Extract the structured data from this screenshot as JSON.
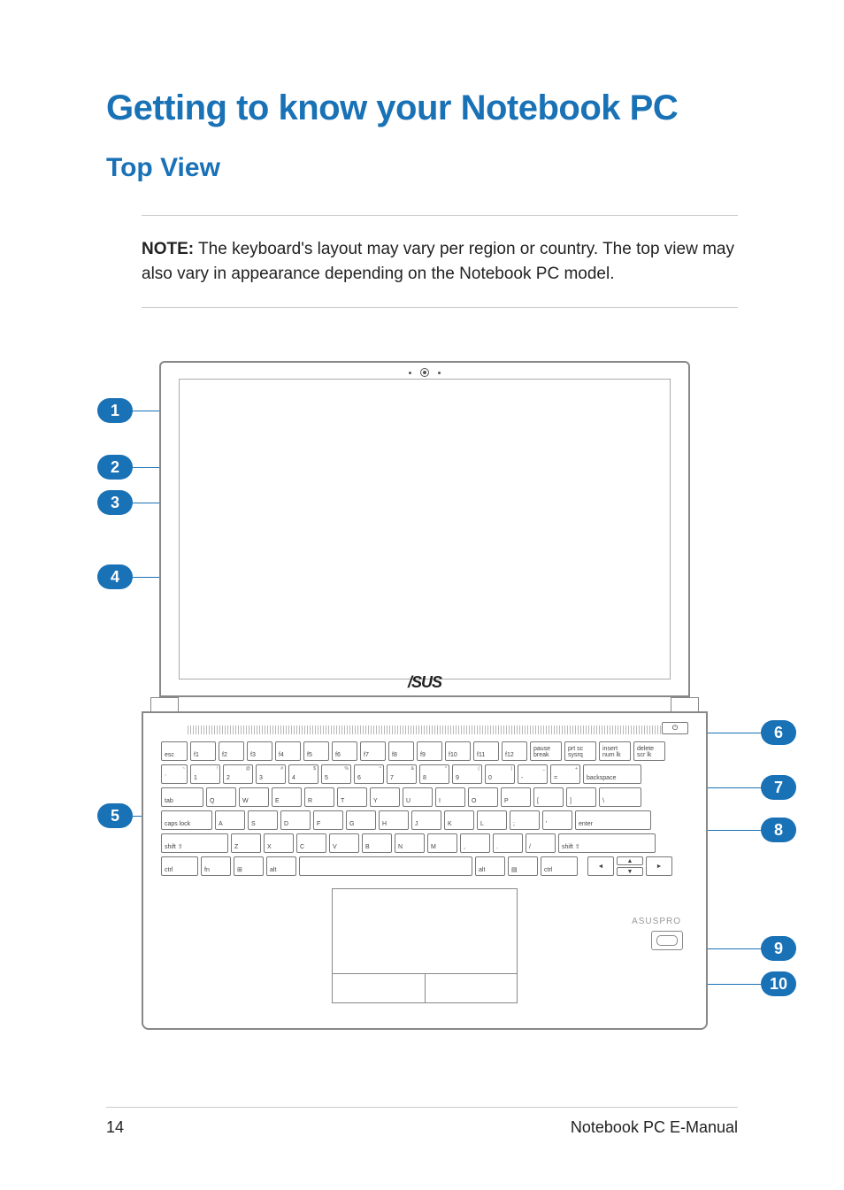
{
  "heading": "Getting to know your Notebook PC",
  "subheading": "Top View",
  "note": {
    "label": "NOTE:",
    "text": " The keyboard's layout may vary per region or country. The top view may also vary in appearance depending on the Notebook PC model."
  },
  "callouts": [
    "1",
    "2",
    "3",
    "4",
    "5",
    "6",
    "7",
    "8",
    "9",
    "10"
  ],
  "laptop": {
    "logo": "/SUS",
    "branding": "ASUSPRO",
    "power_icon": "⏻",
    "rows": {
      "fn": [
        "esc",
        "f1",
        "f2",
        "f3",
        "f4",
        "f5",
        "f6",
        "f7",
        "f8",
        "f9",
        "f10",
        "f11",
        "f12",
        "pause break",
        "prt sc sysrq",
        "insert num lk",
        "delete scr lk"
      ],
      "num": [
        "`",
        "1",
        "2",
        "3",
        "4",
        "5",
        "6",
        "7",
        "8",
        "9",
        "0",
        "-",
        "=",
        "backspace"
      ],
      "num_tr": [
        "~",
        "!",
        "@",
        "#",
        "$",
        "%",
        "^",
        "&",
        "*",
        "(",
        ")",
        "_",
        "+",
        ""
      ],
      "q": [
        "tab",
        "Q",
        "W",
        "E",
        "R",
        "T",
        "Y",
        "U",
        "I",
        "O",
        "P",
        "[",
        "]",
        "\\"
      ],
      "a": [
        "caps lock",
        "A",
        "S",
        "D",
        "F",
        "G",
        "H",
        "J",
        "K",
        "L",
        ";",
        "'",
        "enter"
      ],
      "z": [
        "shift ⇧",
        "Z",
        "X",
        "C",
        "V",
        "B",
        "N",
        "M",
        ",",
        ".",
        "/",
        "shift ⇧"
      ],
      "ctrl": [
        "ctrl",
        "fn",
        "⊞",
        "alt",
        " ",
        "alt",
        "▤",
        "ctrl"
      ],
      "arrows": [
        "◄",
        "▲",
        "▼",
        "►"
      ]
    }
  },
  "footer": {
    "page": "14",
    "title": "Notebook PC E-Manual"
  }
}
